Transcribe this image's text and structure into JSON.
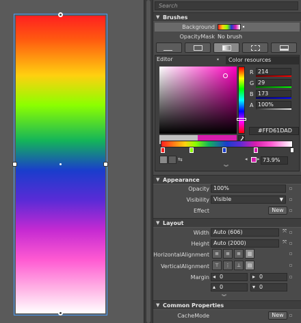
{
  "search": {
    "placeholder": "Search"
  },
  "brushes": {
    "header": "Brushes",
    "background_label": "Background",
    "opacitymask_label": "OpacityMask",
    "opacitymask_value": "No brush",
    "tabs": [
      "no-brush-icon",
      "solid-brush-icon",
      "gradient-brush-icon",
      "tile-brush-icon",
      "resource-brush-icon"
    ],
    "editor_tab": "Editor",
    "resources_tab": "Color resources",
    "channels": [
      {
        "label": "R",
        "value": "214",
        "color": "#e03030"
      },
      {
        "label": "G",
        "value": "29",
        "color": "#30c040"
      },
      {
        "label": "B",
        "value": "173",
        "color": "#3050e0"
      },
      {
        "label": "A",
        "value": "100%",
        "color": "#cccccc"
      }
    ],
    "hex": "#FFD61DAD",
    "selected_color": "#d61dad",
    "stop_offset": "73.9%"
  },
  "appearance": {
    "header": "Appearance",
    "opacity_label": "Opacity",
    "opacity_value": "100%",
    "visibility_label": "Visibility",
    "visibility_value": "Visible",
    "effect_label": "Effect",
    "effect_button": "New"
  },
  "layout": {
    "header": "Layout",
    "width_label": "Width",
    "width_value": "Auto (606)",
    "height_label": "Height",
    "height_value": "Auto (2000)",
    "halign_label": "HorizontalAlignment",
    "valign_label": "VerticalAlignment",
    "margin_label": "Margin",
    "margins": [
      "0",
      "0",
      "0",
      "0"
    ]
  },
  "common": {
    "header": "Common Properties",
    "cachemode_label": "CacheMode",
    "cachemode_button": "New"
  }
}
